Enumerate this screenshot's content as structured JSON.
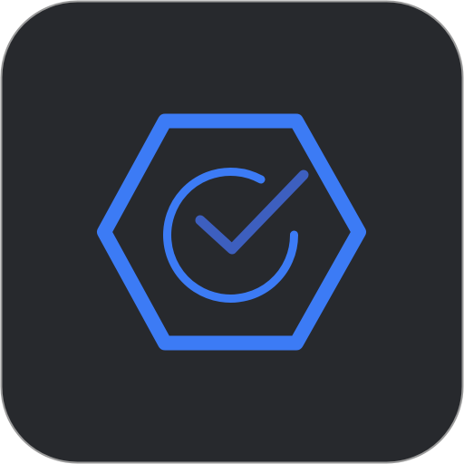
{
  "icon": {
    "name": "hexagon-check-app-icon",
    "glyphs": [
      "hexagon-icon",
      "circle-check-icon"
    ]
  },
  "colors": {
    "tile_background": "#27292d",
    "tile_border": "#9a9a9a",
    "hexagon_stroke": "#3c7bf5",
    "ring_stroke": "#3c7bf5",
    "check_stroke": "#3d5fbf"
  }
}
